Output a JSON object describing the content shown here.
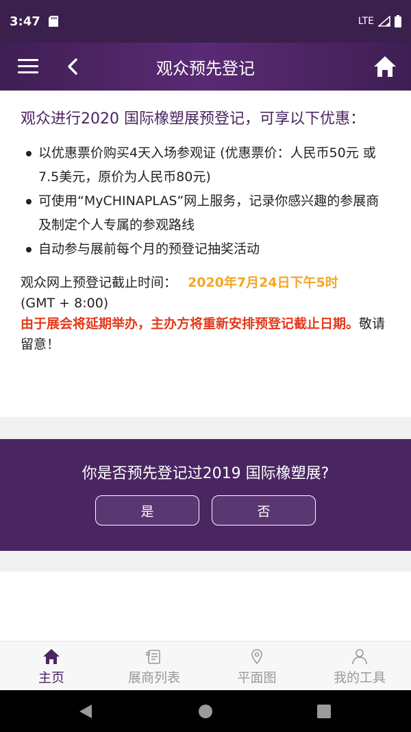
{
  "status": {
    "time": "3:47",
    "network": "LTE"
  },
  "header": {
    "title": "观众预先登记"
  },
  "content": {
    "intro": "观众进行2020 国际橡塑展预登记，可享以下优惠：",
    "bullets": [
      "以优惠票价购买4天入场参观证 (优惠票价：人民币50元 或 7.5美元，原价为人民币80元)",
      "可使用“MyCHINAPLAS”网上服务，记录你感兴趣的参展商及制定个人专属的参观路线",
      "自动参与展前每个月的预登记抽奖活动"
    ],
    "deadline_label": "观众网上预登记截止时间：",
    "deadline_date": "2020年7月24日下午5时",
    "deadline_tz": "(GMT + 8:00)",
    "notice_red": "由于展会将延期举办，主办方将重新安排预登记截止日期。",
    "notice_tail": "敬请留意！"
  },
  "question": {
    "text": "你是否预先登记过2019 国际橡塑展?",
    "yes_label": "是",
    "no_label": "否"
  },
  "bottom_nav": {
    "items": [
      {
        "label": "主页",
        "icon": "home-icon"
      },
      {
        "label": "展商列表",
        "icon": "list-icon"
      },
      {
        "label": "平面图",
        "icon": "map-pin-icon"
      },
      {
        "label": "我的工具",
        "icon": "person-icon"
      }
    ]
  },
  "colors": {
    "primary": "#4a2661",
    "accent_orange": "#f5a623",
    "alert_red": "#e33b1c"
  }
}
